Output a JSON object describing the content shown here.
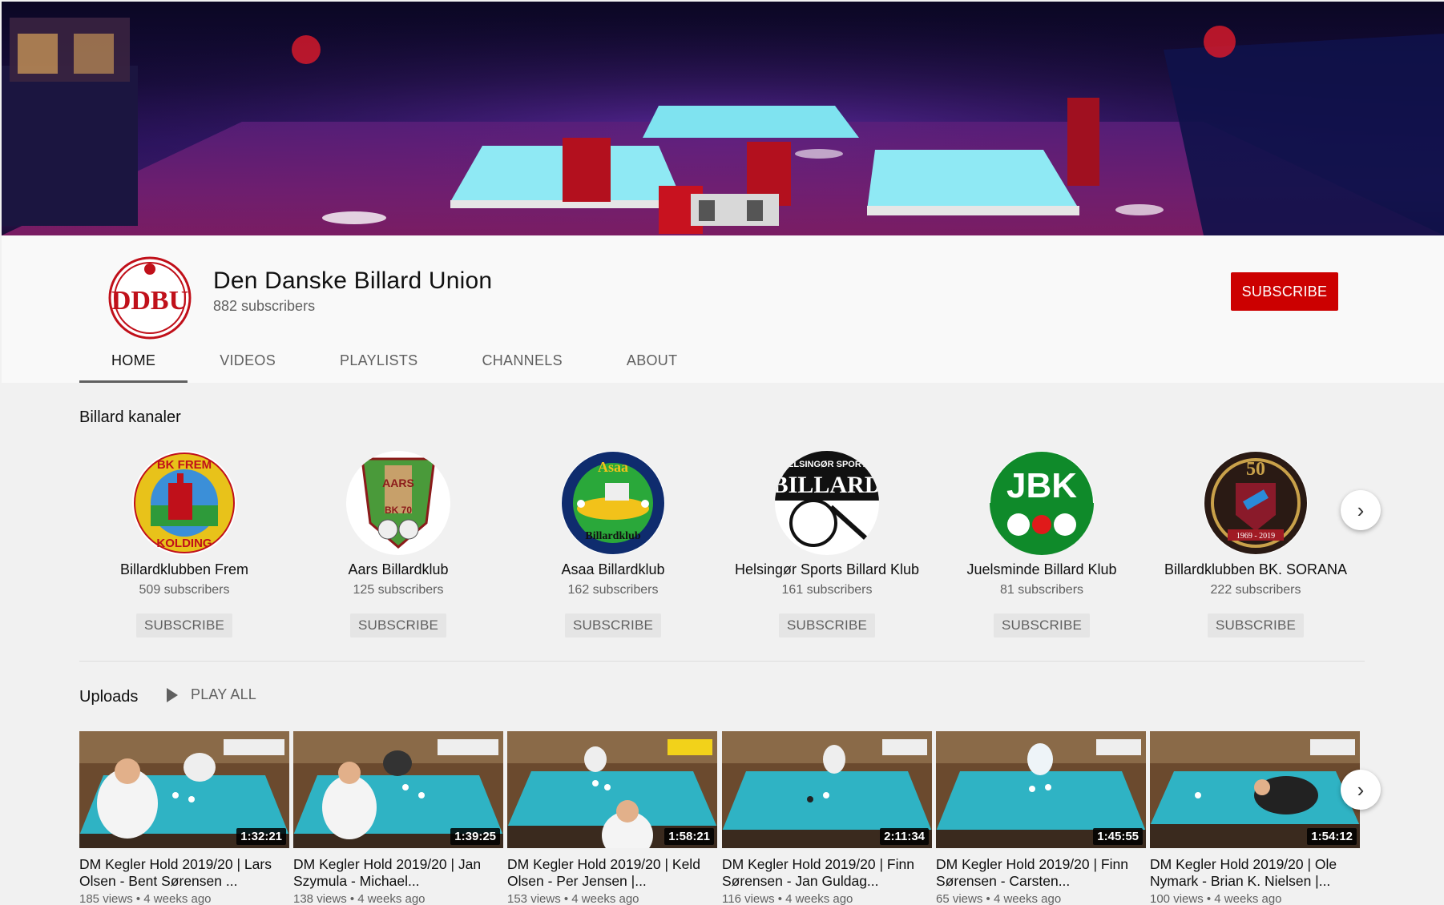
{
  "channel": {
    "title": "Den Danske Billard Union",
    "subscribers": "882 subscribers",
    "subscribe_label": "SUBSCRIBE",
    "avatar_text": "DDBU"
  },
  "tabs": [
    {
      "label": "HOME",
      "active": true
    },
    {
      "label": "VIDEOS"
    },
    {
      "label": "PLAYLISTS"
    },
    {
      "label": "CHANNELS"
    },
    {
      "label": "ABOUT"
    }
  ],
  "channels_shelf": {
    "title": "Billard kanaler",
    "items": [
      {
        "name": "Billardklubben Frem",
        "subs": "509 subscribers",
        "button": "SUBSCRIBE",
        "logo_top": "BK FREM",
        "logo_bottom": "KOLDING"
      },
      {
        "name": "Aars Billardklub",
        "subs": "125 subscribers",
        "button": "SUBSCRIBE",
        "logo_top": "AARS",
        "logo_bottom": "BK 70"
      },
      {
        "name": "Asaa Billardklub",
        "subs": "162 subscribers",
        "button": "SUBSCRIBE",
        "logo_top": "Asaa",
        "logo_bottom": "Billardklub"
      },
      {
        "name": "Helsingør Sports Billard Klub",
        "subs": "161 subscribers",
        "button": "SUBSCRIBE",
        "logo_top": "HELSINGØR SPORTS",
        "logo_bottom": "BILLARD"
      },
      {
        "name": "Juelsminde Billard Klub",
        "subs": "81 subscribers",
        "button": "SUBSCRIBE",
        "logo_top": "JBK",
        "logo_bottom": ""
      },
      {
        "name": "Billardklubben BK. SORANA",
        "subs": "222 subscribers",
        "button": "SUBSCRIBE",
        "logo_top": "50",
        "logo_bottom": "1969 - 2019"
      }
    ]
  },
  "uploads": {
    "title": "Uploads",
    "play_all": "PLAY ALL",
    "videos": [
      {
        "title": "DM Kegler Hold 2019/20 | Lars Olsen - Bent Sørensen ...",
        "meta": "185 views • 4 weeks ago",
        "duration": "1:32:21"
      },
      {
        "title": "DM Kegler Hold 2019/20 | Jan Szymula - Michael...",
        "meta": "138 views • 4 weeks ago",
        "duration": "1:39:25"
      },
      {
        "title": "DM Kegler Hold 2019/20 | Keld Olsen - Per Jensen |...",
        "meta": "153 views • 4 weeks ago",
        "duration": "1:58:21"
      },
      {
        "title": "DM Kegler Hold 2019/20 | Finn Sørensen - Jan Guldag...",
        "meta": "116 views • 4 weeks ago",
        "duration": "2:11:34"
      },
      {
        "title": "DM Kegler Hold 2019/20 | Finn Sørensen - Carsten...",
        "meta": "65 views • 4 weeks ago",
        "duration": "1:45:55"
      },
      {
        "title": "DM Kegler Hold 2019/20 | Ole Nymark - Brian K. Nielsen |...",
        "meta": "100 views • 4 weeks ago",
        "duration": "1:54:12"
      }
    ]
  },
  "colors": {
    "brand_red": "#cc0000",
    "table_cloth": "#2fb3c4",
    "header_bg": "#f9f9f9",
    "page_bg": "#f1f1f1"
  }
}
